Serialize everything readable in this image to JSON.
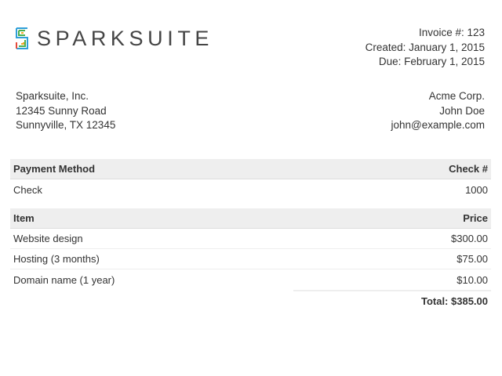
{
  "brand": {
    "name": "SPARKSUITE",
    "colors": [
      "#e64a3b",
      "#f5a623",
      "#4caf50",
      "#2f9fd8"
    ]
  },
  "invoice": {
    "number_line": "Invoice #: 123",
    "created_line": "Created: January 1, 2015",
    "due_line": "Due: February 1, 2015"
  },
  "from": {
    "company": "Sparksuite, Inc.",
    "street": "12345 Sunny Road",
    "city": "Sunnyville, TX 12345"
  },
  "to": {
    "company": "Acme Corp.",
    "contact": "John Doe",
    "email": "john@example.com"
  },
  "payment": {
    "header_left": "Payment Method",
    "header_right": "Check #",
    "method": "Check",
    "check_number": "1000"
  },
  "items": {
    "header_left": "Item",
    "header_right": "Price",
    "rows": [
      {
        "name": "Website design",
        "price": "$300.00"
      },
      {
        "name": "Hosting (3 months)",
        "price": "$75.00"
      },
      {
        "name": "Domain name (1 year)",
        "price": "$10.00"
      }
    ],
    "total": "Total: $385.00"
  }
}
